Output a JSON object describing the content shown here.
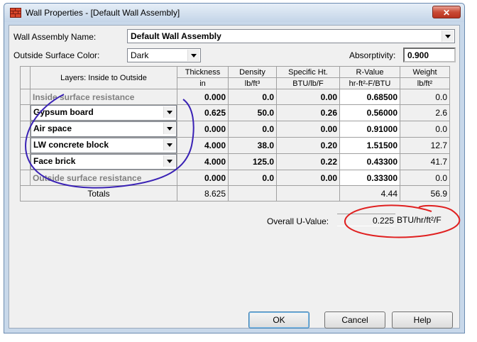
{
  "window": {
    "title": "Wall Properties - [Default Wall Assembly]",
    "close_label": "✕"
  },
  "assembly_name": {
    "label": "Wall Assembly Name:",
    "value": "Default Wall Assembly"
  },
  "surface_color": {
    "label": "Outside Surface Color:",
    "value": "Dark"
  },
  "absorptivity": {
    "label": "Absorptivity:",
    "value": "0.900"
  },
  "columns": [
    {
      "line1": "Layers: Inside to Outside",
      "line2": ""
    },
    {
      "line1": "Thickness",
      "line2": "in"
    },
    {
      "line1": "Density",
      "line2": "lb/ft³"
    },
    {
      "line1": "Specific Ht.",
      "line2": "BTU/lb/F"
    },
    {
      "line1": "R-Value",
      "line2": "hr-ft²-F/BTU"
    },
    {
      "line1": "Weight",
      "line2": "lb/ft²"
    }
  ],
  "rows": [
    {
      "layer": "Inside surface resistance",
      "thickness": "0.000",
      "density": "0.0",
      "specific_ht": "0.00",
      "r_value": "0.68500",
      "weight": "0.0"
    },
    {
      "layer": "Gypsum board",
      "thickness": "0.625",
      "density": "50.0",
      "specific_ht": "0.26",
      "r_value": "0.56000",
      "weight": "2.6"
    },
    {
      "layer": "Air space",
      "thickness": "0.000",
      "density": "0.0",
      "specific_ht": "0.00",
      "r_value": "0.91000",
      "weight": "0.0"
    },
    {
      "layer": "LW concrete block",
      "thickness": "4.000",
      "density": "38.0",
      "specific_ht": "0.20",
      "r_value": "1.51500",
      "weight": "12.7"
    },
    {
      "layer": "Face brick",
      "thickness": "4.000",
      "density": "125.0",
      "specific_ht": "0.22",
      "r_value": "0.43300",
      "weight": "41.7"
    },
    {
      "layer": "Outside surface resistance",
      "thickness": "0.000",
      "density": "0.0",
      "specific_ht": "0.00",
      "r_value": "0.33300",
      "weight": "0.0"
    }
  ],
  "totals": {
    "label": "Totals",
    "thickness": "8.625",
    "r_value": "4.44",
    "weight": "56.9"
  },
  "u_value": {
    "label": "Overall U-Value:",
    "value": "0.225",
    "unit": "BTU/hr/ft²/F"
  },
  "buttons": {
    "ok": "OK",
    "cancel": "Cancel",
    "help": "Help"
  },
  "annotation_color": "#e02020",
  "circle_color": "#3a22b5"
}
